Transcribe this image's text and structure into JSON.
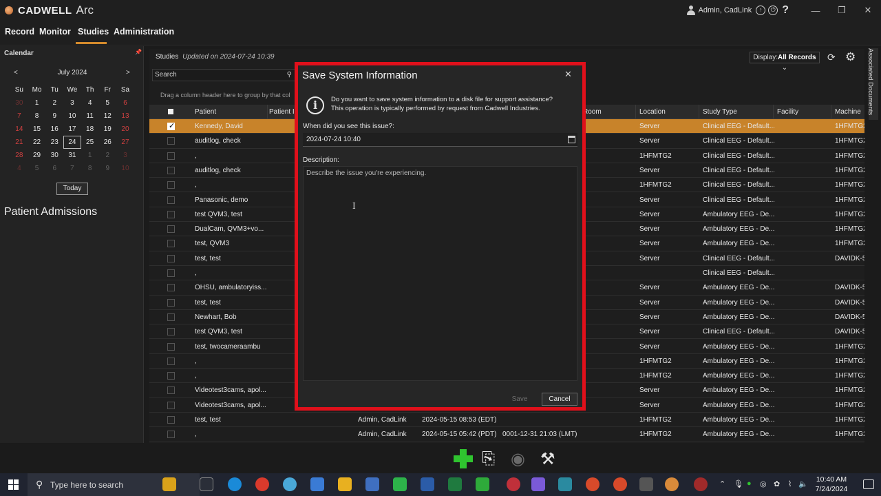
{
  "app": {
    "brand": "CADWELL",
    "product": "Arc",
    "user": "Admin, CadLink",
    "window_buttons": [
      "—",
      "❐",
      "✕"
    ]
  },
  "menu": {
    "items": [
      "Record",
      "Monitor",
      "Studies",
      "Administration"
    ],
    "active": "Studies"
  },
  "calendar": {
    "header": "Calendar",
    "month": "July 2024",
    "prev": "<",
    "next": ">",
    "weekdays": [
      "Su",
      "Mo",
      "Tu",
      "We",
      "Th",
      "Fr",
      "Sa"
    ],
    "weeks": [
      [
        "30",
        "1",
        "2",
        "3",
        "4",
        "5",
        "6"
      ],
      [
        "7",
        "8",
        "9",
        "10",
        "11",
        "12",
        "13"
      ],
      [
        "14",
        "15",
        "16",
        "17",
        "18",
        "19",
        "20"
      ],
      [
        "21",
        "22",
        "23",
        "24",
        "25",
        "26",
        "27"
      ],
      [
        "28",
        "29",
        "30",
        "31",
        "1",
        "2",
        "3"
      ],
      [
        "4",
        "5",
        "6",
        "7",
        "8",
        "9",
        "10"
      ]
    ],
    "selected_day": "24",
    "today_button": "Today"
  },
  "patient_admissions": "Patient Admissions",
  "studies": {
    "title": "Studies",
    "updated": "Updated on 2024-07-24 10:39",
    "search_placeholder": "Search",
    "drag_hint": "Drag a column header here to group by that col",
    "display_label": "Display:",
    "display_value": "All Records",
    "columns": [
      "Patient",
      "Patient I",
      "Room",
      "Location",
      "Study Type",
      "Facility",
      "Machine"
    ],
    "rows": [
      {
        "patient": "Kennedy, David",
        "user": "",
        "date": "",
        "date2": "",
        "location": "Server",
        "type": "Clinical EEG - Default...",
        "machine": "1HFMTG2",
        "selected": true
      },
      {
        "patient": "auditlog, check",
        "user": "",
        "date": "",
        "date2": "",
        "location": "Server",
        "type": "Clinical EEG - Default...",
        "machine": "1HFMTG2"
      },
      {
        "patient": ",",
        "user": "",
        "date": "",
        "date2": "",
        "location": "1HFMTG2",
        "type": "Clinical EEG - Default...",
        "machine": "1HFMTG2"
      },
      {
        "patient": "auditlog, check",
        "user": "",
        "date": "",
        "date2": "",
        "location": "Server",
        "type": "Clinical EEG - Default...",
        "machine": "1HFMTG2"
      },
      {
        "patient": ",",
        "user": "",
        "date": "",
        "date2": "",
        "location": "1HFMTG2",
        "type": "Clinical EEG - Default...",
        "machine": "1HFMTG2"
      },
      {
        "patient": "Panasonic, demo",
        "user": "",
        "date": "",
        "date2": "",
        "location": "Server",
        "type": "Clinical EEG - Default...",
        "machine": "1HFMTG2"
      },
      {
        "patient": "test QVM3, test",
        "user": "",
        "date": "",
        "date2": "",
        "location": "Server",
        "type": "Ambulatory EEG - De...",
        "machine": "1HFMTG2"
      },
      {
        "patient": "DualCam, QVM3+vo...",
        "user": "",
        "date": "",
        "date2": "",
        "location": "Server",
        "type": "Ambulatory EEG - De...",
        "machine": "1HFMTG2"
      },
      {
        "patient": "test, QVM3",
        "user": "",
        "date": "",
        "date2": "",
        "location": "Server",
        "type": "Ambulatory EEG - De...",
        "machine": "1HFMTG2"
      },
      {
        "patient": "test, test",
        "user": "",
        "date": "",
        "date2": "",
        "location": "Server",
        "type": "Clinical EEG - Default...",
        "machine": "DAVIDK-5"
      },
      {
        "patient": ",",
        "user": "",
        "date": "",
        "date2": "",
        "location": "",
        "type": "Clinical EEG - Default...",
        "machine": ""
      },
      {
        "patient": "OHSU, ambulatoryiss...",
        "user": "",
        "date": "",
        "date2": "",
        "location": "Server",
        "type": "Ambulatory EEG - De...",
        "machine": "DAVIDK-5"
      },
      {
        "patient": "test, test",
        "user": "",
        "date": "",
        "date2": "",
        "location": "Server",
        "type": "Ambulatory EEG - De...",
        "machine": "DAVIDK-5"
      },
      {
        "patient": "Newhart, Bob",
        "user": "",
        "date": "",
        "date2": "",
        "location": "Server",
        "type": "Ambulatory EEG - De...",
        "machine": "DAVIDK-5"
      },
      {
        "patient": "test QVM3, test",
        "user": "",
        "date": "",
        "date2": "",
        "location": "Server",
        "type": "Clinical EEG - Default...",
        "machine": "DAVIDK-5"
      },
      {
        "patient": "test, twocameraambu",
        "user": "",
        "date": "",
        "date2": "",
        "location": "Server",
        "type": "Ambulatory EEG - De...",
        "machine": "1HFMTG2"
      },
      {
        "patient": ",",
        "user": "",
        "date": "",
        "date2": "",
        "location": "1HFMTG2",
        "type": "Ambulatory EEG - De...",
        "machine": "1HFMTG2"
      },
      {
        "patient": ",",
        "user": "",
        "date": "",
        "date2": "",
        "location": "1HFMTG2",
        "type": "Ambulatory EEG - De...",
        "machine": "1HFMTG2"
      },
      {
        "patient": "Videotest3cams, apol...",
        "user": "",
        "date": "",
        "date2": "",
        "location": "Server",
        "type": "Ambulatory EEG - De...",
        "machine": "1HFMTG2"
      },
      {
        "patient": "Videotest3cams, apol...",
        "user": "",
        "date": "",
        "date2": "",
        "location": "Server",
        "type": "Ambulatory EEG - De...",
        "machine": "1HFMTG2"
      },
      {
        "patient": "test, test",
        "user": "Admin, CadLink",
        "date": "2024-05-15 08:53 (EDT)",
        "date2": "",
        "location": "1HFMTG2",
        "type": "Ambulatory EEG - De...",
        "machine": "1HFMTG2"
      },
      {
        "patient": ",",
        "user": "Admin, CadLink",
        "date": "2024-05-15 05:42 (PDT)",
        "date2": "0001-12-31 21:03 (LMT)",
        "location": "1HFMTG2",
        "type": "Ambulatory EEG - De...",
        "machine": "1HFMTG2"
      }
    ]
  },
  "side_tab": "Associated Documents",
  "dialog": {
    "title": "Save System Information",
    "close": "✕",
    "message_line1": "Do you want to save system information to a disk file for support assistance?",
    "message_line2": "This operation is typically performed by request from Cadwell Industries.",
    "when_label": "When did you see this issue?:",
    "when_value": "2024-07-24 10:40",
    "description_label": "Description:",
    "description_placeholder": "Describe the issue you're experiencing.",
    "save": "Save",
    "cancel": "Cancel"
  },
  "taskbar": {
    "search_placeholder": "Type here to search",
    "time": "10:40 AM",
    "date": "7/24/2024"
  },
  "colors": {
    "accent": "#d48a2c",
    "selected_row": "#c8832a",
    "dialog_highlight": "#e0101b",
    "weekend": "#d04040"
  }
}
